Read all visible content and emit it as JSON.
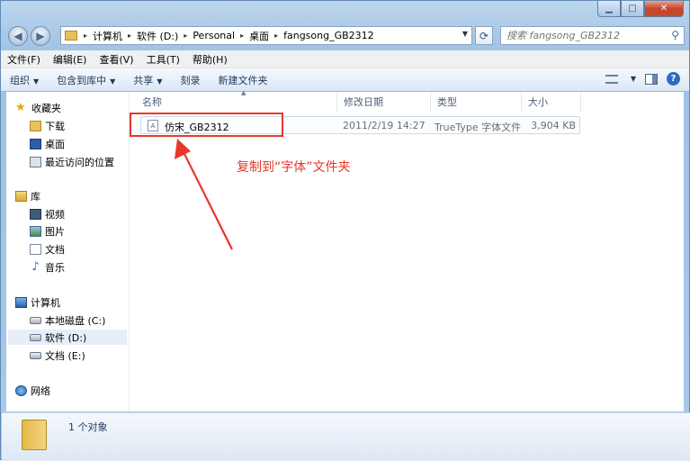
{
  "title_bar": {
    "minimize_glyph": "▁",
    "maximize_glyph": "□",
    "close_glyph": "✕"
  },
  "nav": {
    "back_glyph": "◀",
    "forward_glyph": "▶",
    "refresh_glyph": "⟳"
  },
  "address": {
    "crumbs": [
      "计算机",
      "软件 (D:)",
      "Personal",
      "桌面",
      "fangsong_GB2312"
    ]
  },
  "search": {
    "placeholder": "搜索 fangsong_GB2312"
  },
  "menu": [
    "文件(F)",
    "编辑(E)",
    "查看(V)",
    "工具(T)",
    "帮助(H)"
  ],
  "toolbar": {
    "organize": "组织",
    "include_in_library": "包含到库中",
    "share": "共享",
    "burn": "刻录",
    "new_folder": "新建文件夹",
    "help_glyph": "?"
  },
  "nav_pane": {
    "favorites": "收藏夹",
    "downloads": "下载",
    "desktop": "桌面",
    "recent": "最近访问的位置",
    "libraries": "库",
    "videos": "视频",
    "pictures": "图片",
    "documents": "文档",
    "music": "音乐",
    "computer": "计算机",
    "drive_c": "本地磁盘 (C:)",
    "drive_d": "软件 (D:)",
    "drive_e": "文档 (E:)",
    "network": "网络"
  },
  "columns": {
    "name": "名称",
    "modified": "修改日期",
    "type": "类型",
    "size": "大小"
  },
  "file": {
    "icon_text": "A",
    "name": "仿宋_GB2312",
    "modified": "2011/2/19 14:27",
    "type": "TrueType 字体文件",
    "size": "3,904 KB"
  },
  "annotation": {
    "text": "复制到“字体”文件夹",
    "color": "#e8362a"
  },
  "status": {
    "count": "1 个对象"
  }
}
